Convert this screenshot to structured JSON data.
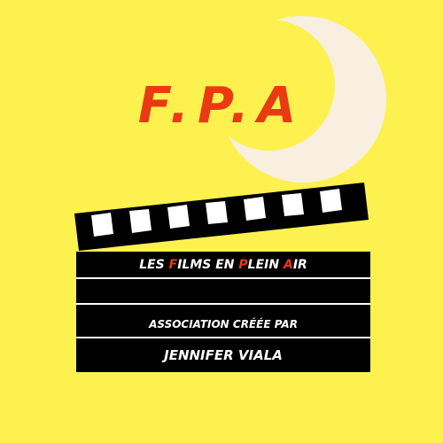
{
  "colors": {
    "background": "#fdf14f",
    "accent": "#ea3a12",
    "moon": "#f8efe0",
    "board": "#000000",
    "text": "#ffffff"
  },
  "icons": {
    "moon": "crescent-moon-icon",
    "clapperboard": "clapperboard-icon"
  },
  "title": "F.P.A",
  "tagline": {
    "part1": "LES ",
    "f": "F",
    "part2": "ILMS EN ",
    "p": "P",
    "part3": "LEIN ",
    "a": "A",
    "part4": "IR"
  },
  "association_label": "ASSOCIATION CRÉÉE PAR",
  "founder": "JENNIFER VIALA"
}
